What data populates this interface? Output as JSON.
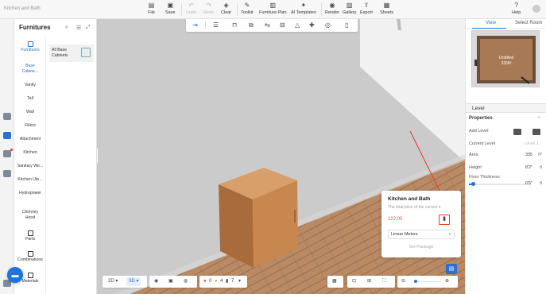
{
  "app": {
    "title": "Kitchen and Bath"
  },
  "toolbar": {
    "file": "File",
    "save": "Save",
    "undo": "Undo",
    "redo": "Redo",
    "clear": "Clear",
    "toolkit": "Toolkit",
    "furniture_plan": "Furniture Plan",
    "ai_templates": "AI Templates",
    "render": "Render",
    "gallery": "Gallery",
    "export": "Export",
    "sheets": "Sheets",
    "help": "Help"
  },
  "icons": {
    "file": "file-icon",
    "save": "save-icon",
    "undo": "undo-icon",
    "redo": "redo-icon",
    "clear": "clear-icon",
    "toolkit": "toolkit-icon",
    "furniture_plan": "furniture-plan-icon",
    "ai_templates": "ai-templates-icon",
    "render": "render-icon",
    "gallery": "gallery-icon",
    "export": "export-icon",
    "sheets": "sheets-icon",
    "help": "help-icon"
  },
  "furniture_panel": {
    "title": "Furnitures",
    "categories": [
      {
        "label": "Furnitures",
        "active": true
      },
      {
        "label": "Base Cabine...",
        "active": true
      },
      {
        "label": "Vanity"
      },
      {
        "label": "Tall"
      },
      {
        "label": "Wall"
      },
      {
        "label": "Fillers"
      },
      {
        "label": "Attachment"
      },
      {
        "label": "Kitchen"
      },
      {
        "label": "Sanitary We..."
      },
      {
        "label": "Kitchen Ute..."
      },
      {
        "label": "Hydropower"
      },
      {
        "label": "Chimney Hood"
      },
      {
        "label": "Parts"
      },
      {
        "label": "Combinations"
      },
      {
        "label": "Materials"
      }
    ],
    "subcategory": "All Base Cabinets"
  },
  "package": {
    "title": "Kitchen and Bath",
    "subtitle": "The total price of the current s",
    "price": "122.00",
    "unit_select": "Linear Meters",
    "set_package": "Set Package"
  },
  "bottom_bar": {
    "view2d": "2D",
    "view3d": "3D",
    "error_count": "0",
    "warning_count": "4",
    "info_count": "7"
  },
  "right_panel": {
    "tabs": [
      "View",
      "Select Room"
    ],
    "minimap_label": "Untitled",
    "minimap_area": "335ft²",
    "level": {
      "title": "Level",
      "properties": "Properties",
      "add_level": "Add Level",
      "current_level": "Current Level",
      "current_level_value": "Level 1",
      "area_label": "Area",
      "area_value": "335",
      "area_unit": "ft²",
      "height_label": "Height",
      "height_value": "8'2\"",
      "height_unit": "ft",
      "floor_label": "Floor Thickness",
      "floor_value": "0'5\"",
      "floor_unit": "ft",
      "floor_slider_fraction": 0.06
    }
  },
  "colors": {
    "accent": "#2a6fd6",
    "price": "#e0533b",
    "highlight": "#e23b2e",
    "wood": "#c8874e"
  }
}
